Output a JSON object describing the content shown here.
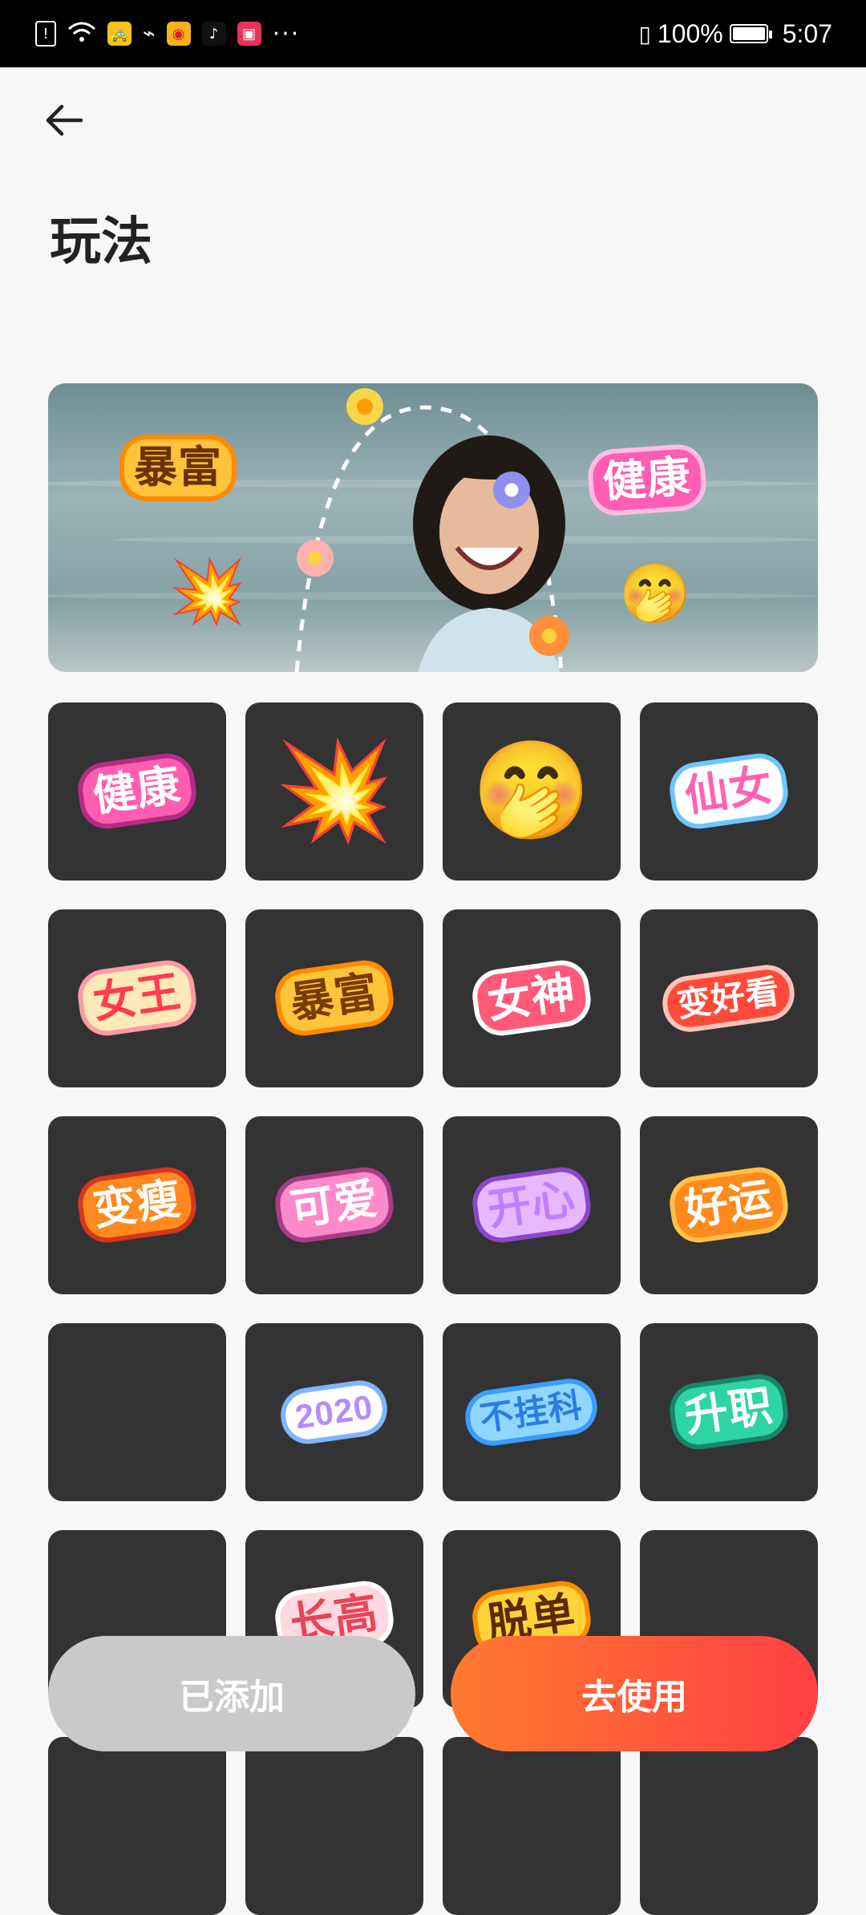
{
  "status_bar": {
    "battery": "100%",
    "time": "5:07",
    "notification_icons": [
      "alert-icon",
      "wifi-icon",
      "taxi-icon",
      "usb-icon",
      "weibo-icon",
      "tiktok-icon",
      "shop-icon",
      "more-icon"
    ]
  },
  "header": {
    "title": "玩法"
  },
  "banner": {
    "sticker_left": "暴富",
    "sticker_right": "健康",
    "emoji_right": "🤭",
    "burst": "💥"
  },
  "stickers": [
    {
      "text": "健康",
      "fg": "#ffffff",
      "bg": "#ff5db1",
      "stroke": "#b52c85"
    },
    {
      "text": "💥",
      "emoji": true
    },
    {
      "text": "🤭",
      "emoji": true
    },
    {
      "text": "仙女",
      "fg": "#ff62b3",
      "bg": "#ffffff",
      "stroke": "#6ec6ff"
    },
    {
      "text": "女王",
      "fg": "#ff3b4f",
      "bg": "#ffe9b8",
      "stroke": "#ff9aa5"
    },
    {
      "text": "暴富",
      "fg": "#7a3b00",
      "bg": "#ffc43a",
      "stroke": "#ff8a00"
    },
    {
      "text": "女神",
      "fg": "#ffffff",
      "bg": "#ff5a7a",
      "stroke": "#ffffff"
    },
    {
      "text": "变好看",
      "fg": "#ffffff",
      "bg": "#ff4a3a",
      "stroke": "#ffc4b8"
    },
    {
      "text": "变瘦",
      "fg": "#ffffff",
      "bg": "#ff8a1f",
      "stroke": "#d9351e"
    },
    {
      "text": "可爱",
      "fg": "#ffffff",
      "bg": "#ff8acb",
      "stroke": "#a83c86"
    },
    {
      "text": "开心",
      "fg": "#c07fff",
      "bg": "#e7b7ff",
      "stroke": "#8b47c9"
    },
    {
      "text": "好运",
      "fg": "#ffffff",
      "bg": "#ff8a1c",
      "stroke": "#ffc14a"
    },
    {
      "text": "",
      "empty": true
    },
    {
      "text": "2020",
      "fg": "#b48cff",
      "bg": "#ffffff",
      "stroke": "#7fb5ff"
    },
    {
      "text": "不挂科",
      "fg": "#2c7be5",
      "bg": "#8fd7ff",
      "stroke": "#3b9cff"
    },
    {
      "text": "升职",
      "fg": "#ffffff",
      "bg": "#2ed4a3",
      "stroke": "#17866a"
    },
    {
      "text": "",
      "empty": true
    },
    {
      "text": "长高",
      "fg": "#e8445a",
      "bg": "#ffd9df",
      "stroke": "#ffffff"
    },
    {
      "text": "脱单",
      "fg": "#5a2a00",
      "bg": "#ffd23a",
      "stroke": "#ff8c00"
    },
    {
      "text": "",
      "empty": true
    },
    {
      "text": "",
      "empty": true
    },
    {
      "text": "",
      "empty": true
    },
    {
      "text": "",
      "empty": true
    },
    {
      "text": "",
      "empty": true
    }
  ],
  "buttons": {
    "added_label": "已添加",
    "use_label": "去使用"
  },
  "colors": {
    "tile_bg": "#333333",
    "use_gradient_start": "#ff7a2e",
    "use_gradient_end": "#ff3f45",
    "added_bg": "#c9c9c9"
  }
}
